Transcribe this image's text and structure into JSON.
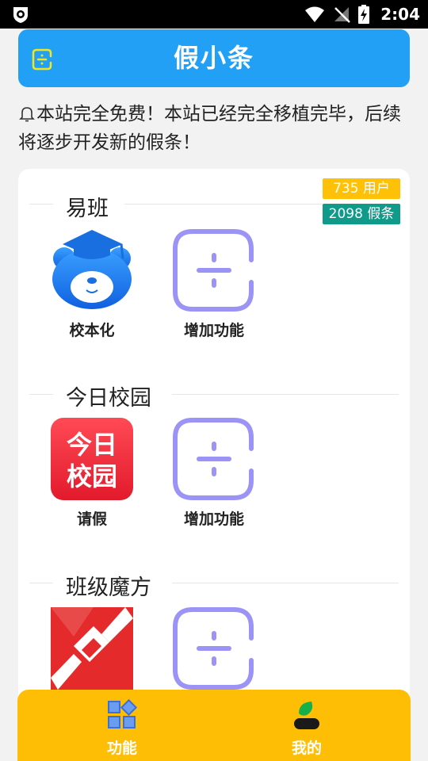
{
  "status_bar": {
    "time": "2:04"
  },
  "header": {
    "title": "假小条"
  },
  "notice": {
    "text": "本站完全免费！本站已经完全移植完毕，后续将逐步开发新的假条！"
  },
  "stats": {
    "users": "735 用户",
    "slips": "2098 假条"
  },
  "sections": [
    {
      "title": "易班",
      "tiles": [
        {
          "label": "校本化",
          "icon": "yiban-bear-icon"
        },
        {
          "label": "增加功能",
          "icon": "add-function-icon"
        }
      ]
    },
    {
      "title": "今日校园",
      "tiles": [
        {
          "label": "请假",
          "icon": "jinri-xiaoyuan-icon",
          "icon_text": "今日校园"
        },
        {
          "label": "增加功能",
          "icon": "add-function-icon"
        }
      ]
    },
    {
      "title": "班级魔方",
      "tiles": [
        {
          "label": "",
          "icon": "banji-mofang-icon"
        },
        {
          "label": "",
          "icon": "add-function-icon"
        }
      ]
    }
  ],
  "bottom_nav": [
    {
      "label": "功能",
      "icon": "grid-icon"
    },
    {
      "label": "我的",
      "icon": "profile-icon"
    }
  ],
  "colors": {
    "header": "#22a0f5",
    "nav": "#ffbe06",
    "users_badge": "#ffc107",
    "slips_badge": "#109a8a",
    "add_icon": "#9b93f5"
  }
}
